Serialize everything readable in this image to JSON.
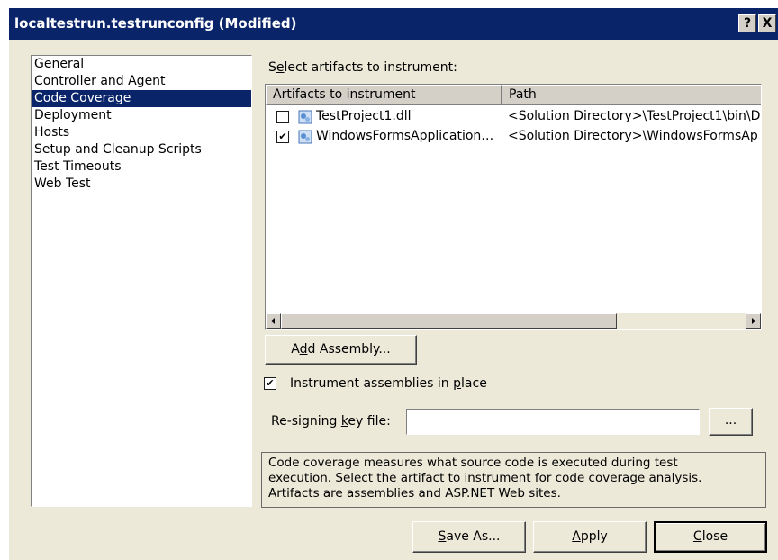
{
  "window": {
    "title": "localtestrun.testrunconfig (Modified)",
    "help_button": "?",
    "close_button": "X"
  },
  "nav": {
    "items": [
      {
        "label": "General"
      },
      {
        "label": "Controller and Agent"
      },
      {
        "label": "Code Coverage",
        "selected": true
      },
      {
        "label": "Deployment"
      },
      {
        "label": "Hosts"
      },
      {
        "label": "Setup and Cleanup Scripts"
      },
      {
        "label": "Test Timeouts"
      },
      {
        "label": "Web Test"
      }
    ]
  },
  "artifacts": {
    "label_prefix": "S",
    "label_accel": "e",
    "label_rest": "lect artifacts to instrument:",
    "columns": [
      "Artifacts to instrument",
      "Path"
    ],
    "rows": [
      {
        "checked": false,
        "name": "TestProject1.dll",
        "path": "<Solution Directory>\\TestProject1\\bin\\D"
      },
      {
        "checked": true,
        "name": "WindowsFormsApplication…",
        "path": "<Solution Directory>\\WindowsFormsAp"
      }
    ]
  },
  "buttons": {
    "add_assembly": {
      "pre": "A",
      "accel": "d",
      "post": "d Assembly..."
    },
    "browse": "...",
    "save_as": {
      "pre": "",
      "accel": "S",
      "post": "ave As..."
    },
    "apply": {
      "pre": "",
      "accel": "A",
      "post": "pply"
    },
    "close": {
      "pre": "",
      "accel": "C",
      "post": "lose"
    }
  },
  "instrument_in_place": {
    "checked": true,
    "pre": "Instrument assemblies in ",
    "accel": "p",
    "post": "lace"
  },
  "resigning": {
    "pre": "Re-signing ",
    "accel": "k",
    "post": "ey file:",
    "value": ""
  },
  "description": {
    "lines": [
      "Code coverage measures what source code is executed during test",
      "execution. Select the artifact to instrument for code coverage analysis.",
      "Artifacts are assemblies and ASP.NET Web sites."
    ]
  },
  "colors": {
    "title_bar": "#0a246a",
    "selection": "#0a246a",
    "dialog_face": "#ece9d8"
  }
}
